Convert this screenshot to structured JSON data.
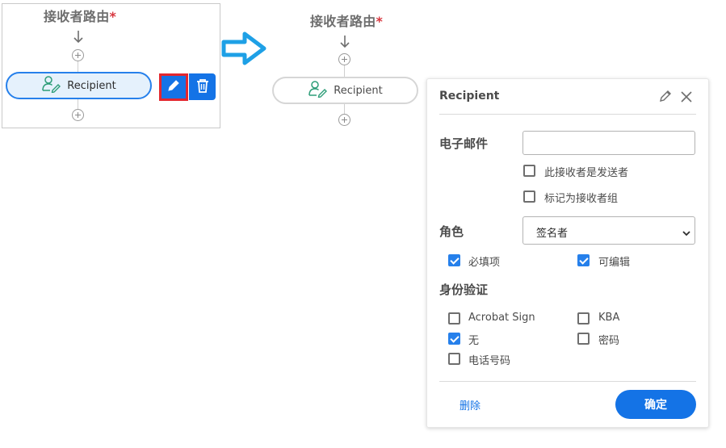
{
  "left_flow": {
    "title": "接收者路由",
    "required_mark": "*",
    "recipient_label": "Recipient"
  },
  "right_flow": {
    "title": "接收者路由",
    "required_mark": "*",
    "recipient_label": "Recipient"
  },
  "panel": {
    "header_title": "Recipient",
    "email_label": "电子邮件",
    "email_value": "",
    "sender_checkbox": {
      "label": "此接收者是发送者",
      "checked": false
    },
    "group_checkbox": {
      "label": "标记为接收者组",
      "checked": false
    },
    "role_label": "角色",
    "role_selected": "签名者",
    "required_checkbox": {
      "label": "必填项",
      "checked": true
    },
    "editable_checkbox": {
      "label": "可编辑",
      "checked": true
    },
    "auth_label": "身份验证",
    "auth_options": {
      "acrobat_sign": {
        "label": "Acrobat Sign",
        "checked": false
      },
      "kba": {
        "label": "KBA",
        "checked": false
      },
      "none": {
        "label": "无",
        "checked": true
      },
      "password": {
        "label": "密码",
        "checked": false
      },
      "phone": {
        "label": "电话号码",
        "checked": false
      }
    },
    "delete_label": "删除",
    "ok_label": "确定"
  },
  "colors": {
    "accent_blue": "#2680eb",
    "button_blue": "#1473e6",
    "highlight_red": "#e3262e",
    "arrow_blue": "#1ea0e6"
  }
}
